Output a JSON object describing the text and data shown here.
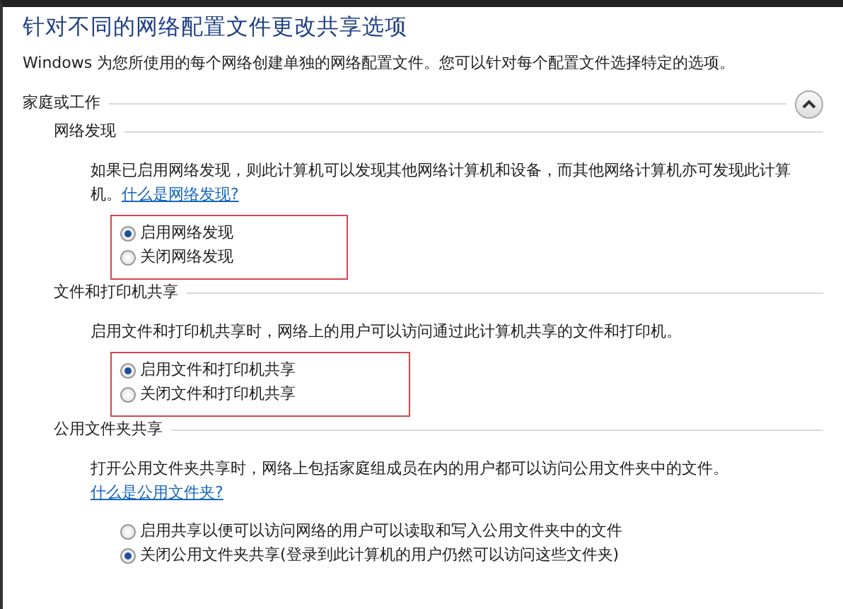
{
  "title": "针对不同的网络配置文件更改共享选项",
  "intro": "Windows 为您所使用的每个网络创建单独的网络配置文件。您可以针对每个配置文件选择特定的选项。",
  "profile": {
    "label": "家庭或工作",
    "expanded": true
  },
  "sections": [
    {
      "heading": "网络发现",
      "description": "如果已启用网络发现，则此计算机可以发现其他网络计算机和设备，而其他网络计算机亦可发现此计算机。",
      "link": "什么是网络发现?",
      "highlighted": true,
      "options": [
        {
          "label": "启用网络发现",
          "selected": true
        },
        {
          "label": "关闭网络发现",
          "selected": false
        }
      ]
    },
    {
      "heading": "文件和打印机共享",
      "description": "启用文件和打印机共享时，网络上的用户可以访问通过此计算机共享的文件和打印机。",
      "highlighted": true,
      "options": [
        {
          "label": "启用文件和打印机共享",
          "selected": true
        },
        {
          "label": "关闭文件和打印机共享",
          "selected": false
        }
      ]
    },
    {
      "heading": "公用文件夹共享",
      "description": "打开公用文件夹共享时，网络上包括家庭组成员在内的用户都可以访问公用文件夹中的文件。",
      "link": "什么是公用文件夹?",
      "highlighted": false,
      "options": [
        {
          "label": "启用共享以便可以访问网络的用户可以读取和写入公用文件夹中的文件",
          "selected": false
        },
        {
          "label": "关闭公用文件夹共享(登录到此计算机的用户仍然可以访问这些文件夹)",
          "selected": true
        }
      ]
    }
  ]
}
